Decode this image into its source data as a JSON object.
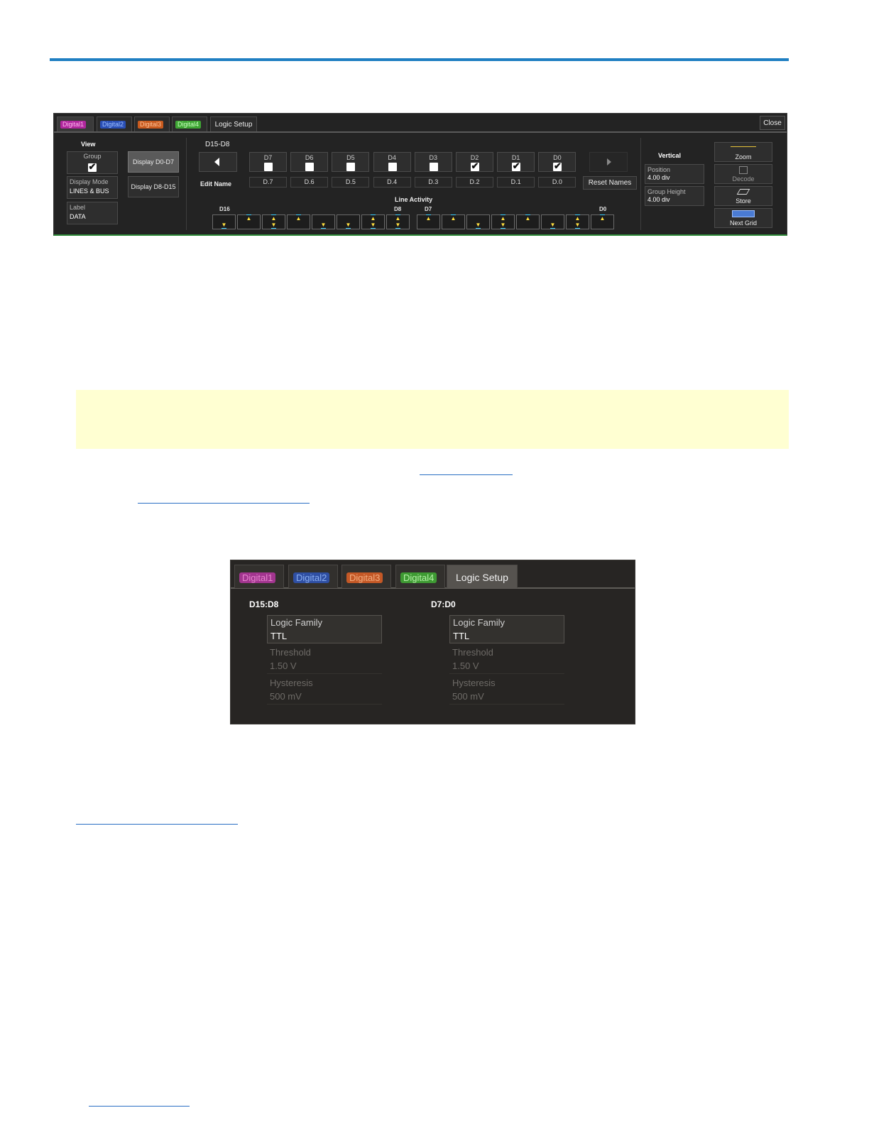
{
  "colors": {
    "rule": "#1f7fc2",
    "note_bg": "#ffffd2",
    "digital1": "#b0279d",
    "digital2": "#2a4fb5",
    "digital3": "#c85a1e",
    "digital4": "#3fa534"
  },
  "panel1": {
    "tabs": [
      "Digital1",
      "Digital2",
      "Digital3",
      "Digital4",
      "Logic Setup"
    ],
    "close": "Close",
    "view": {
      "title": "View",
      "group_caption": "Group",
      "group_checked": true,
      "display_mode_caption": "Display Mode",
      "display_mode_value": "LINES & BUS",
      "label_caption": "Label",
      "label_value": "DATA"
    },
    "display_buttons": [
      "Display D0-D7",
      "Display D8-D15"
    ],
    "range_title": "D15-D8",
    "edit_name": "Edit Name",
    "channels": [
      {
        "label": "D7",
        "checked": false,
        "name": "D.7"
      },
      {
        "label": "D6",
        "checked": false,
        "name": "D.6"
      },
      {
        "label": "D5",
        "checked": false,
        "name": "D.5"
      },
      {
        "label": "D4",
        "checked": false,
        "name": "D.4"
      },
      {
        "label": "D3",
        "checked": false,
        "name": "D.3"
      },
      {
        "label": "D2",
        "checked": true,
        "name": "D.2"
      },
      {
        "label": "D1",
        "checked": true,
        "name": "D.1"
      },
      {
        "label": "D0",
        "checked": true,
        "name": "D.0"
      }
    ],
    "reset_names": "Reset Names",
    "line_activity": {
      "title": "Line Activity",
      "labels": [
        "D16",
        "D8",
        "D7",
        "D0"
      ],
      "states": [
        "low",
        "high",
        "both",
        "high",
        "low",
        "low",
        "both",
        "both",
        "high",
        "high",
        "low",
        "both",
        "high",
        "low",
        "both",
        "high"
      ]
    },
    "vertical": {
      "title": "Vertical",
      "position_caption": "Position",
      "position_value": "4.00 div",
      "height_caption": "Group Height",
      "height_value": "4.00 div"
    },
    "actions": [
      "Zoom",
      "Decode",
      "Store",
      "Next Grid"
    ]
  },
  "panel2": {
    "tabs": [
      "Digital1",
      "Digital2",
      "Digital3",
      "Digital4",
      "Logic Setup"
    ],
    "groups": [
      {
        "title": "D15:D8",
        "logic_family_caption": "Logic Family",
        "logic_family_value": "TTL",
        "threshold_caption": "Threshold",
        "threshold_value": "1.50 V",
        "hysteresis_caption": "Hysteresis",
        "hysteresis_value": "500 mV"
      },
      {
        "title": "D7:D0",
        "logic_family_caption": "Logic Family",
        "logic_family_value": "TTL",
        "threshold_caption": "Threshold",
        "threshold_value": "1.50 V",
        "hysteresis_caption": "Hysteresis",
        "hysteresis_value": "500 mV"
      }
    ]
  }
}
